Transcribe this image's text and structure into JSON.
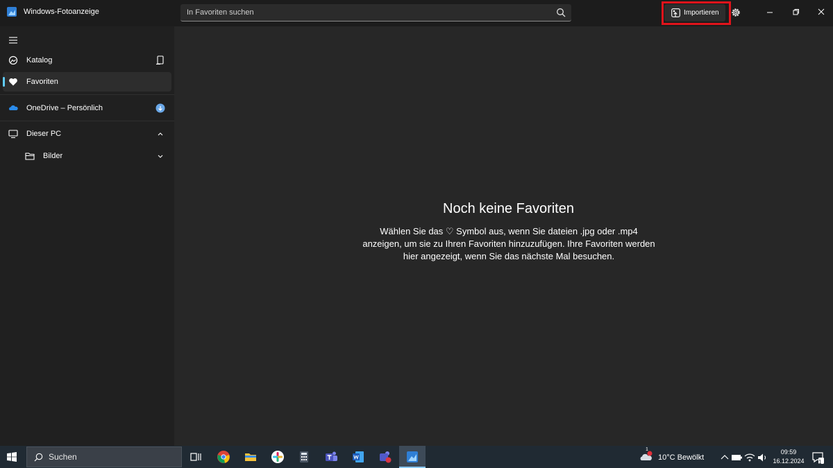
{
  "window": {
    "title": "Windows-Fotoanzeige"
  },
  "search": {
    "placeholder": "In Favoriten suchen"
  },
  "toolbar": {
    "import_label": "Importieren"
  },
  "sidebar": {
    "items": [
      {
        "label": "Katalog"
      },
      {
        "label": "Favoriten"
      },
      {
        "label": "OneDrive – Persönlich"
      },
      {
        "label": "Dieser PC"
      },
      {
        "label": "Bilder"
      }
    ]
  },
  "main": {
    "empty_title": "Noch keine Favoriten",
    "empty_text": "Wählen Sie das ♡ Symbol aus, wenn Sie dateien .jpg oder .mp4 anzeigen, um sie zu Ihren Favoriten hinzuzufügen. Ihre Favoriten werden hier angezeigt, wenn Sie das nächste Mal besuchen."
  },
  "taskbar": {
    "search_label": "Suchen",
    "weather": "10°C  Bewölkt",
    "weather_badge": "1",
    "time": "09:59",
    "date": "16.12.2024",
    "notification_count": "1"
  },
  "colors": {
    "accent": "#60cdff",
    "highlight": "#e0131b",
    "background": "#202020"
  }
}
